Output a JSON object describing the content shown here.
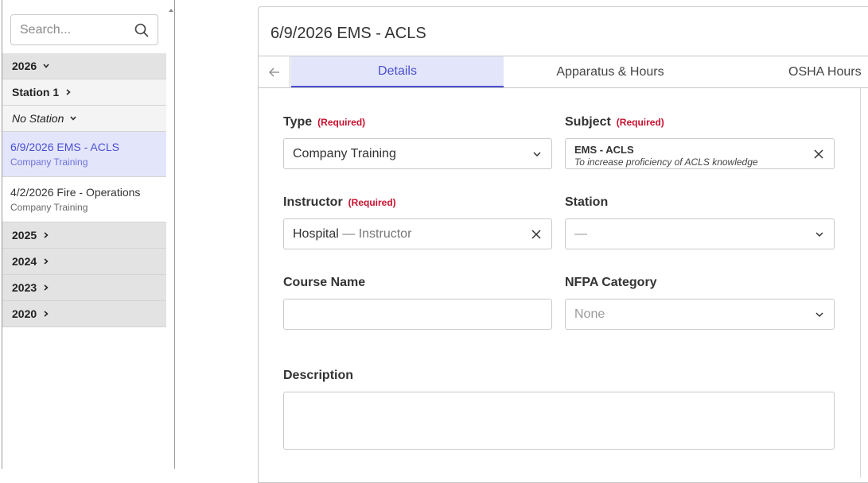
{
  "sidebar": {
    "search_placeholder": "Search...",
    "years": [
      {
        "label": "2026"
      },
      {
        "label": "2025"
      },
      {
        "label": "2024"
      },
      {
        "label": "2023"
      },
      {
        "label": "2020"
      }
    ],
    "station_1": "Station 1",
    "no_station": "No Station",
    "entries": [
      {
        "title": "6/9/2026 EMS - ACLS",
        "sub": "Company Training"
      },
      {
        "title": "4/2/2026 Fire - Operations",
        "sub": "Company Training"
      }
    ]
  },
  "main": {
    "title": "6/9/2026 EMS - ACLS",
    "tabs": [
      "Details",
      "Apparatus & Hours",
      "OSHA Hours"
    ],
    "required_text": "(Required)",
    "fields": {
      "type": {
        "label": "Type",
        "value": "Company Training"
      },
      "subject": {
        "label": "Subject",
        "value": "EMS - ACLS",
        "description": "To increase proficiency of ACLS knowledge"
      },
      "instructor": {
        "label": "Instructor",
        "value": "Hospital",
        "value_suffix": "— Instructor"
      },
      "station": {
        "label": "Station",
        "placeholder": "—"
      },
      "course_name": {
        "label": "Course Name",
        "value": ""
      },
      "nfpa_category": {
        "label": "NFPA Category",
        "value": "None"
      },
      "description": {
        "label": "Description",
        "value": ""
      }
    }
  },
  "colors": {
    "accent": "#4b4fd0",
    "active_bg": "#e3e6fb",
    "required": "#c8102e",
    "year_bg": "#e3e3e3"
  },
  "icons": {
    "search": "search-icon",
    "chevron_down": "chevron-down-icon",
    "chevron_right": "chevron-right-icon",
    "clear": "close-icon",
    "back": "arrow-left-icon"
  }
}
